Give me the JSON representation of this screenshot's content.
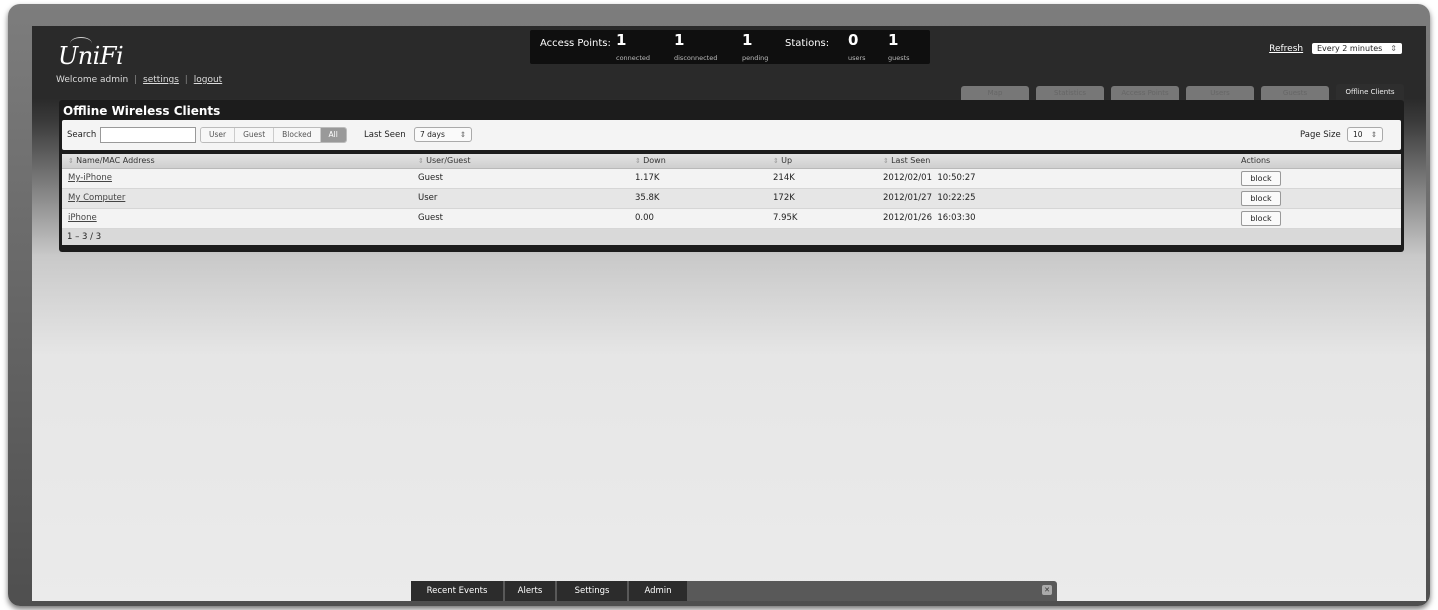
{
  "app": {
    "logo": "UniFi"
  },
  "user_bar": {
    "welcome": "Welcome admin",
    "settings": "settings",
    "logout": "logout"
  },
  "stats": {
    "access_points_label": "Access Points:",
    "connected": {
      "value": "1",
      "label": "connected"
    },
    "disconnected": {
      "value": "1",
      "label": "disconnected"
    },
    "pending": {
      "value": "1",
      "label": "pending"
    },
    "stations_label": "Stations:",
    "users": {
      "value": "0",
      "label": "users"
    },
    "guests": {
      "value": "1",
      "label": "guests"
    }
  },
  "refresh": {
    "label": "Refresh",
    "interval": "Every 2 minutes"
  },
  "tabs": [
    "Map",
    "Statistics",
    "Access Points",
    "Users",
    "Guests",
    "Offline Clients"
  ],
  "panel": {
    "title": "Offline Wireless Clients"
  },
  "filters": {
    "search_label": "Search",
    "search_value": "",
    "segments": [
      "User",
      "Guest",
      "Blocked",
      "All"
    ],
    "last_seen_label": "Last Seen",
    "last_seen_value": "7 days",
    "page_size_label": "Page Size",
    "page_size_value": "10"
  },
  "table": {
    "columns": [
      "Name/MAC Address",
      "User/Guest",
      "Down",
      "Up",
      "Last Seen",
      "Actions"
    ],
    "rows": [
      {
        "name": "My-iPhone",
        "type": "Guest",
        "down": "1.17K",
        "up": "214K",
        "last_seen": "2012/02/01  10:50:27",
        "action": "block"
      },
      {
        "name": "My Computer",
        "type": "User",
        "down": "35.8K",
        "up": "172K",
        "last_seen": "2012/01/27  10:22:25",
        "action": "block"
      },
      {
        "name": "iPhone",
        "type": "Guest",
        "down": "0.00",
        "up": "7.95K",
        "last_seen": "2012/01/26  16:03:30",
        "action": "block"
      }
    ],
    "footer": "1 – 3 / 3"
  },
  "bottom_tabs": [
    "Recent Events",
    "Alerts",
    "Settings",
    "Admin"
  ]
}
